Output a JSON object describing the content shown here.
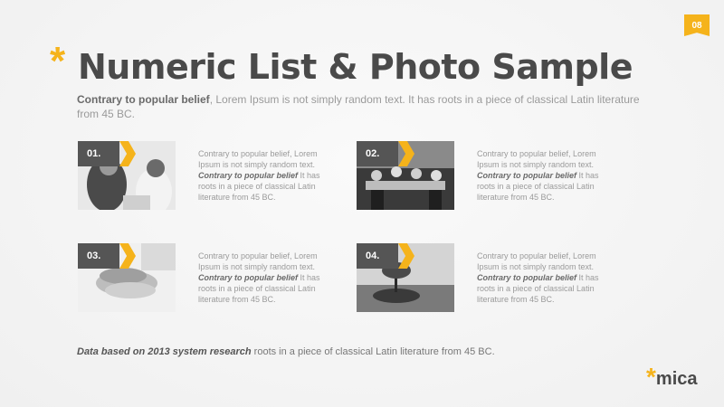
{
  "page_number": "08",
  "title": "Numeric List & Photo Sample",
  "subtitle": {
    "bold": "Contrary to popular belief",
    "rest": ", Lorem Ipsum is not simply random text. It has roots in a piece of classical Latin literature from 45 BC."
  },
  "items": [
    {
      "number": "01.",
      "line1": "Contrary to popular belief, Lorem Ipsum is not simply random text.",
      "bold": "Contrary to popular belief",
      "rest": " It has roots in a piece of classical Latin literature from 45 BC.",
      "photo": "business-meeting-photo"
    },
    {
      "number": "02.",
      "line1": "Contrary to popular belief, Lorem Ipsum is not simply random text.",
      "bold": "Contrary to popular belief",
      "rest": " It has roots in a piece of classical Latin literature from 45 BC.",
      "photo": "team-table-photo"
    },
    {
      "number": "03.",
      "line1": "Contrary to popular belief, Lorem Ipsum is not simply random text.",
      "bold": "Contrary to popular belief",
      "rest": " It has roots in a piece of classical Latin literature from 45 BC.",
      "photo": "stacked-hands-photo"
    },
    {
      "number": "04.",
      "line1": "Contrary to popular belief, Lorem Ipsum is not simply random text.",
      "bold": "Contrary to popular belief",
      "rest": " It has roots in a piece of classical Latin literature from 45 BC.",
      "photo": "hand-tree-photo"
    }
  ],
  "footer": {
    "bold": "Data based on 2013 system research",
    "rest": " roots in a piece of classical Latin literature from 45 BC."
  },
  "logo": {
    "star": "*",
    "text": "mica"
  },
  "colors": {
    "accent": "#f5b31b",
    "dark": "#555555"
  }
}
